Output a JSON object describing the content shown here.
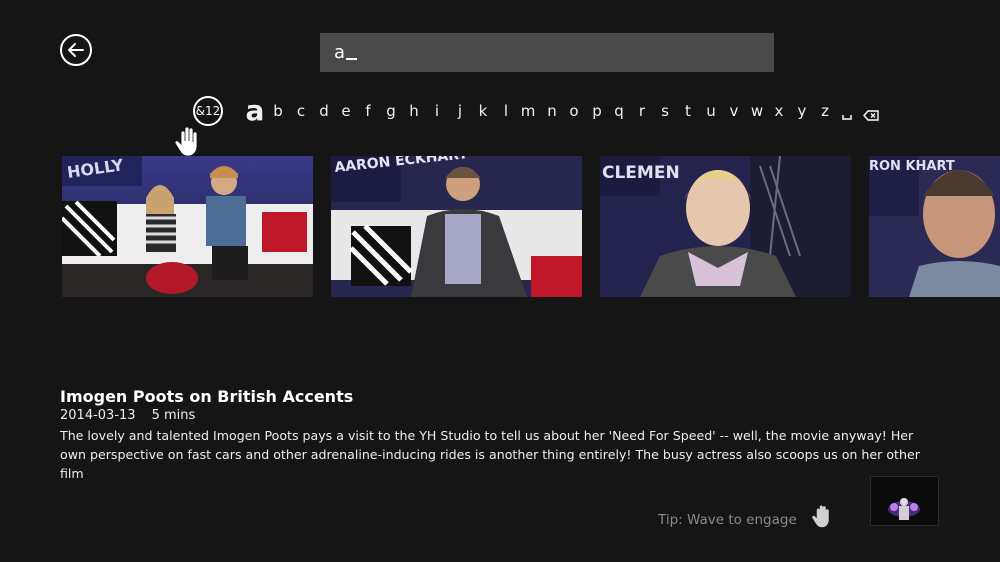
{
  "search": {
    "value": "a"
  },
  "keyboard": {
    "symbol_key": "&12",
    "letters": [
      "a",
      "b",
      "c",
      "d",
      "e",
      "f",
      "g",
      "h",
      "i",
      "j",
      "k",
      "l",
      "m",
      "n",
      "o",
      "p",
      "q",
      "r",
      "s",
      "t",
      "u",
      "v",
      "w",
      "x",
      "y",
      "z"
    ],
    "selected": "a"
  },
  "thumbnails": [
    {
      "banner": "HOLLY"
    },
    {
      "banner": "AARON ECKHART"
    },
    {
      "banner": "CLEMEN"
    },
    {
      "banner": "RON KHART"
    }
  ],
  "video": {
    "title": "Imogen Poots on British Accents",
    "date": "2014-03-13",
    "duration": "5 mins",
    "description": "The lovely and talented Imogen Poots pays a visit to the YH Studio to tell us about her 'Need For Speed' -- well, the movie anyway! Her own perspective on fast cars and other adrenaline-inducing rides is another thing entirely! The busy actress also scoops us on her other film"
  },
  "tip": {
    "text": "Tip: Wave to engage"
  },
  "icons": {
    "back": "back-arrow-icon",
    "space": "space-key-icon",
    "backspace": "backspace-icon",
    "hand": "hand-cursor-icon"
  }
}
